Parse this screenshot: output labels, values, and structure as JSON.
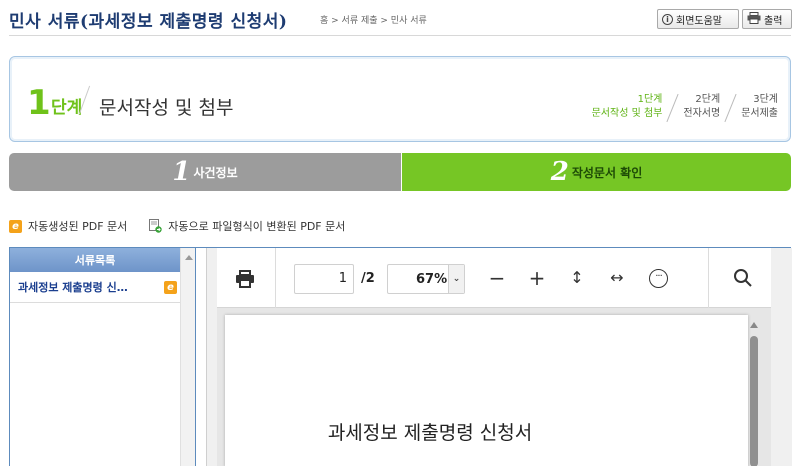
{
  "header": {
    "title": "민사 서류(과세정보 제출명령 신청서)",
    "breadcrumb": "홈 > 서류 제출 > 민사 서류",
    "help_button": "회면도움말",
    "print_button": "출력"
  },
  "step_box": {
    "current_number": "1",
    "current_word": "단계",
    "current_title": "문서작성 및 첨부",
    "steps": [
      {
        "line1": "1단계",
        "line2": "문서작성 및 첨부",
        "active": true
      },
      {
        "line1": "2단계",
        "line2": "전자서명",
        "active": false
      },
      {
        "line1": "3단계",
        "line2": "문서제출",
        "active": false
      }
    ]
  },
  "progress_tabs": [
    {
      "number": "1",
      "label": "사건정보",
      "active": false
    },
    {
      "number": "2",
      "label": "작성문서 확인",
      "active": true
    }
  ],
  "pdf_links": {
    "generated": "자동생성된 PDF 문서",
    "converted": "자동으로 파일형식이 변환된 PDF 문서"
  },
  "sidebar": {
    "header": "서류목록",
    "items": [
      {
        "label": "과세정보 제출명령 신…"
      }
    ]
  },
  "viewer": {
    "current_page": "1",
    "total_pages": "/2",
    "zoom": "67%",
    "document_heading": "과세정보 제출명령 신청서"
  },
  "colors": {
    "title": "#1e3c72",
    "step_green": "#6fc21a",
    "tab_gray": "#9c9c9c",
    "tab_green": "#76c625",
    "frame_blue": "#5d8bbd"
  }
}
